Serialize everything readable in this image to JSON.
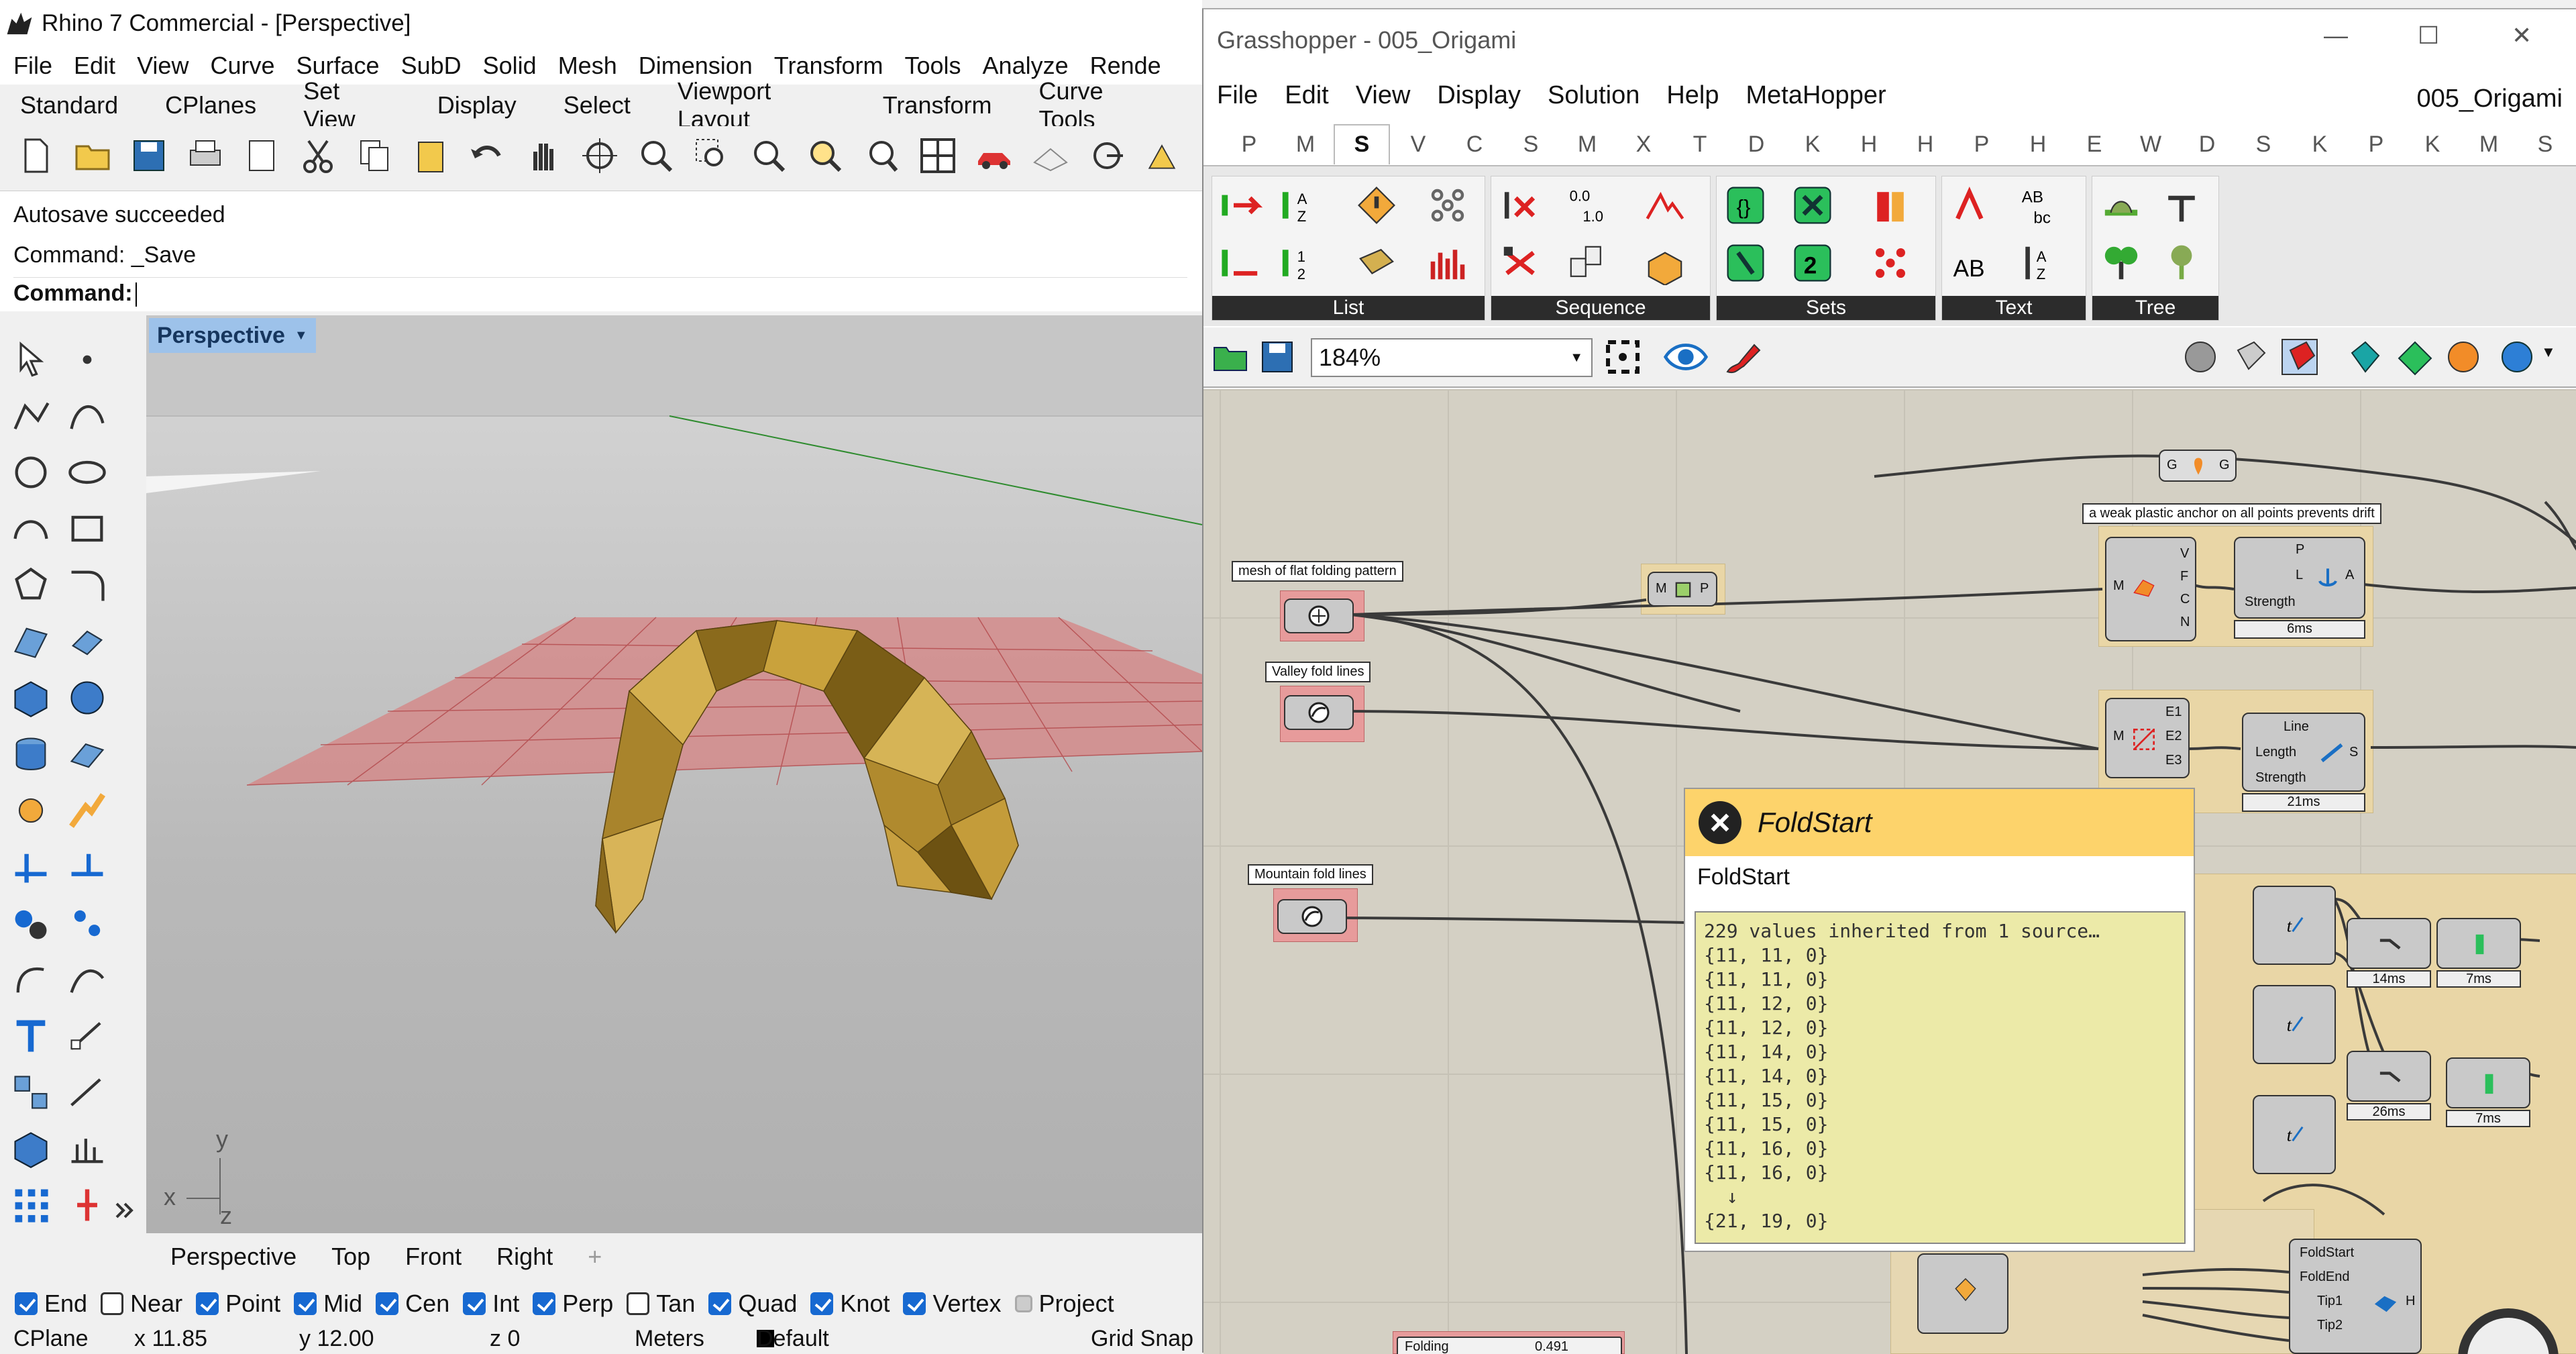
{
  "rhino": {
    "title": "Rhino 7 Commercial - [Perspective]",
    "menu": [
      "File",
      "Edit",
      "View",
      "Curve",
      "Surface",
      "SubD",
      "Solid",
      "Mesh",
      "Dimension",
      "Transform",
      "Tools",
      "Analyze",
      "Rende"
    ],
    "tabs": [
      "Standard",
      "CPlanes",
      "Set View",
      "Display",
      "Select",
      "Viewport Layout",
      "Transform",
      "Curve Tools"
    ],
    "command_history": [
      "Autosave succeeded",
      "Command: _Save"
    ],
    "command_prompt": "Command:",
    "viewport_label": "Perspective",
    "axis_x": "x",
    "axis_y": "y",
    "axis_z": "z",
    "view_tabs": [
      "Perspective",
      "Top",
      "Front",
      "Right"
    ],
    "osnaps": [
      {
        "label": "End",
        "checked": true
      },
      {
        "label": "Near",
        "checked": false
      },
      {
        "label": "Point",
        "checked": true
      },
      {
        "label": "Mid",
        "checked": true
      },
      {
        "label": "Cen",
        "checked": true
      },
      {
        "label": "Int",
        "checked": true
      },
      {
        "label": "Perp",
        "checked": true
      },
      {
        "label": "Tan",
        "checked": false
      },
      {
        "label": "Quad",
        "checked": true
      },
      {
        "label": "Knot",
        "checked": true
      },
      {
        "label": "Vertex",
        "checked": true
      },
      {
        "label": "Project",
        "checked": false
      }
    ],
    "status": {
      "cplane": "CPlane",
      "x": "x 11.85",
      "y": "y 12.00",
      "z": "z 0",
      "units": "Meters",
      "layer": "Default",
      "snap": "Grid Snap"
    }
  },
  "gh": {
    "title": "Grasshopper - 005_Origami",
    "menu": [
      "File",
      "Edit",
      "View",
      "Display",
      "Solution",
      "Help",
      "MetaHopper"
    ],
    "doc": "005_Origami",
    "tabs": [
      "P",
      "M",
      "S",
      "V",
      "C",
      "S",
      "M",
      "X",
      "T",
      "D",
      "K",
      "H",
      "H",
      "P",
      "H",
      "E",
      "W",
      "D",
      "S",
      "K",
      "P",
      "K",
      "M",
      "S"
    ],
    "ribbon_groups": [
      "List",
      "Sequence",
      "Sets",
      "Text",
      "Tree"
    ],
    "zoom": "184%",
    "canvas": {
      "labels": {
        "mesh": "mesh of flat folding pattern",
        "valley": "Valley fold lines",
        "mountain": "Mountain fold lines",
        "anchor": "a weak plastic anchor on all points prevents drift"
      },
      "anchor_ports_in": [
        "V",
        "F",
        "C",
        "N"
      ],
      "anchor_goal_ports": [
        "P",
        "L",
        "Strength"
      ],
      "anchor_out": "A",
      "anchor_time": "6ms",
      "line_goal_ports": [
        "Line",
        "Length",
        "Strength"
      ],
      "line_out": "S",
      "line_time": "21ms",
      "explode_out": [
        "E1",
        "E2",
        "E3"
      ],
      "mp_ports": [
        "M",
        "P"
      ],
      "gg_ports": [
        "G",
        "G"
      ],
      "times": [
        "14ms",
        "7ms",
        "26ms",
        "7ms"
      ],
      "bottom_ports": [
        "FoldStart",
        "FoldEnd",
        "Tip1",
        "Tip2"
      ],
      "bottom_out": "H",
      "slider_label": "Folding",
      "slider_value": "0.491"
    },
    "tooltip": {
      "title": "FoldStart",
      "subtitle": "FoldStart",
      "lines": [
        "229 values inherited from 1 source…",
        "{11, 11, 0}",
        "{11, 11, 0}",
        "{11, 12, 0}",
        "{11, 12, 0}",
        "{11, 14, 0}",
        "{11, 14, 0}",
        "{11, 15, 0}",
        "{11, 15, 0}",
        "{11, 16, 0}",
        "{11, 16, 0}",
        "  ↓",
        "{21, 19, 0}"
      ]
    }
  }
}
